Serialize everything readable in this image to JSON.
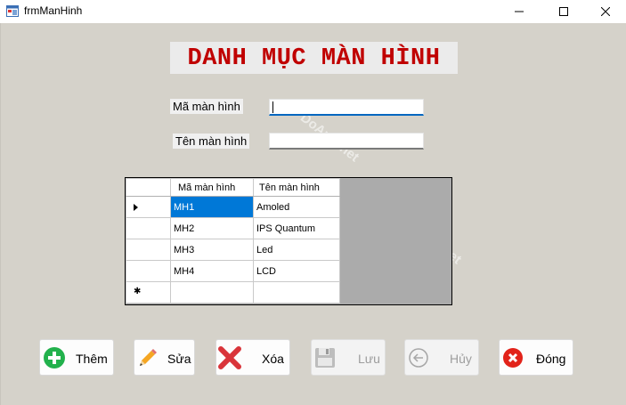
{
  "window": {
    "title": "frmManHinh"
  },
  "heading": "DANH MỤC MÀN HÌNH",
  "form": {
    "ma_label": "Mã màn hình",
    "ma_value": "",
    "ten_label": "Tên màn hình",
    "ten_value": ""
  },
  "grid": {
    "columns": [
      "Mã màn hình",
      "Tên màn hình"
    ],
    "rows": [
      {
        "ma": "MH1",
        "ten": "Amoled"
      },
      {
        "ma": "MH2",
        "ten": "IPS Quantum"
      },
      {
        "ma": "MH3",
        "ten": "Led"
      },
      {
        "ma": "MH4",
        "ten": "LCD"
      }
    ],
    "selected_row": 0
  },
  "buttons": {
    "them": "Thêm",
    "sua": "Sửa",
    "xoa": "Xóa",
    "luu": "Lưu",
    "huy": "Hủy",
    "dong": "Đóng"
  },
  "watermark": "DoAnIT.net",
  "icons": {
    "app": "form-icon",
    "minimize": "minimize-icon",
    "maximize": "maximize-icon",
    "close": "close-icon",
    "them": "plus-circle-icon",
    "sua": "pencil-icon",
    "xoa": "x-mark-icon",
    "luu": "floppy-icon",
    "huy": "back-arrow-icon",
    "dong": "close-circle-icon"
  },
  "colors": {
    "heading_text": "#c00000",
    "selection": "#0078d7",
    "add_green": "#22b14c",
    "delete_red": "#d9343a"
  }
}
